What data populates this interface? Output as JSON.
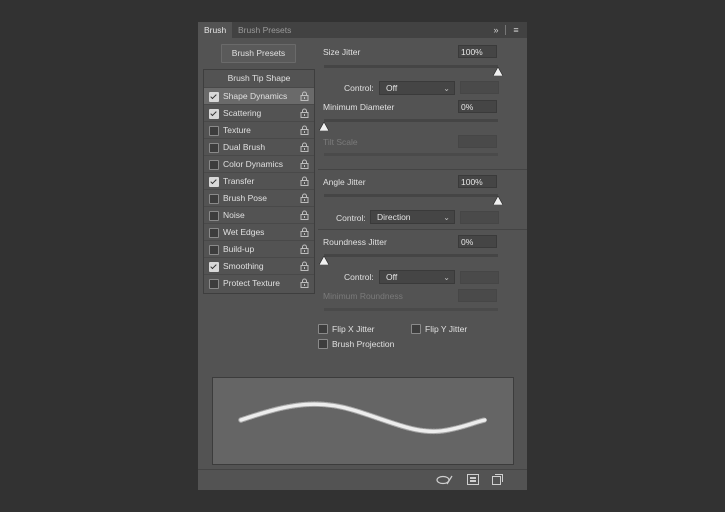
{
  "tabs": [
    {
      "label": "Brush",
      "active": true
    },
    {
      "label": "Brush Presets",
      "active": false
    }
  ],
  "tab_icons": [
    "expand-icon",
    "menu-icon"
  ],
  "presets_button": "Brush Presets",
  "list": {
    "header": "Brush Tip Shape",
    "items": [
      {
        "label": "Shape Dynamics",
        "checked": true,
        "selected": true
      },
      {
        "label": "Scattering",
        "checked": true,
        "selected": false
      },
      {
        "label": "Texture",
        "checked": false,
        "selected": false
      },
      {
        "label": "Dual Brush",
        "checked": false,
        "selected": false
      },
      {
        "label": "Color Dynamics",
        "checked": false,
        "selected": false
      },
      {
        "label": "Transfer",
        "checked": true,
        "selected": false
      },
      {
        "label": "Brush Pose",
        "checked": false,
        "selected": false
      },
      {
        "label": "Noise",
        "checked": false,
        "selected": false
      },
      {
        "label": "Wet Edges",
        "checked": false,
        "selected": false
      },
      {
        "label": "Build-up",
        "checked": false,
        "selected": false
      },
      {
        "label": "Smoothing",
        "checked": true,
        "selected": false
      },
      {
        "label": "Protect Texture",
        "checked": false,
        "selected": false
      }
    ]
  },
  "settings": {
    "size_jitter": {
      "label": "Size Jitter",
      "value": "100%",
      "level": 1.0
    },
    "size_control": {
      "label": "Control:",
      "value": "Off"
    },
    "min_diameter": {
      "label": "Minimum Diameter",
      "value": "0%",
      "level": 0.0
    },
    "tilt_scale": {
      "label": "Tilt Scale",
      "value": ""
    },
    "angle_jitter": {
      "label": "Angle Jitter",
      "value": "100%",
      "level": 1.0
    },
    "angle_control": {
      "label": "Control:",
      "value": "Direction"
    },
    "roundness_jitter": {
      "label": "Roundness Jitter",
      "value": "0%",
      "level": 0.0
    },
    "roundness_control": {
      "label": "Control:",
      "value": "Off"
    },
    "min_roundness": {
      "label": "Minimum Roundness",
      "value": ""
    },
    "flip_x": {
      "label": "Flip X Jitter",
      "checked": false
    },
    "flip_y": {
      "label": "Flip Y Jitter",
      "checked": false
    },
    "projection": {
      "label": "Brush Projection",
      "checked": false
    }
  },
  "bottom_icons": [
    "toggle-preview-icon",
    "grid-icon",
    "create-brush-icon"
  ],
  "colors": {
    "panel": "#535353",
    "background": "#323232",
    "stroke": "#ffffff"
  }
}
